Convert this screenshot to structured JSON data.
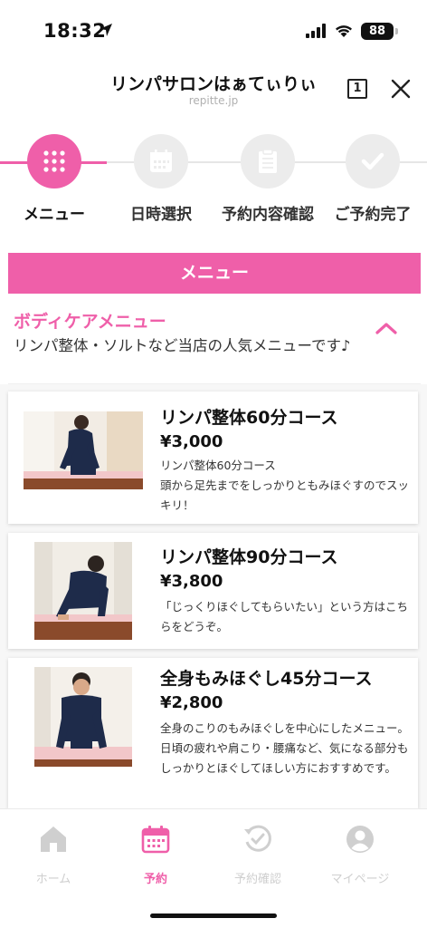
{
  "status_bar": {
    "time": "18:32",
    "battery": "88"
  },
  "header": {
    "title": "リンパサロンはぁてぃりぃ",
    "domain": "repitte.jp",
    "tabs_count": "1"
  },
  "steps": [
    {
      "label": "メニュー",
      "icon": "grid-dots-icon",
      "active": true
    },
    {
      "label": "日時選択",
      "icon": "calendar-icon",
      "active": false
    },
    {
      "label": "予約内容確認",
      "icon": "clipboard-icon",
      "active": false
    },
    {
      "label": "ご予約完了",
      "icon": "check-icon",
      "active": false
    }
  ],
  "section_title": "メニュー",
  "category": {
    "title": "ボディケアメニュー",
    "description": "リンパ整体・ソルトなど当店の人気メニューです♪"
  },
  "menu_items": [
    {
      "name": "リンパ整体60分コース",
      "price": "¥3,000",
      "subtitle": "リンパ整体60分コース",
      "description": "頭から足先までをしっかりともみほぐすのでスッキリ！"
    },
    {
      "name": "リンパ整体90分コース",
      "price": "¥3,800",
      "subtitle": "",
      "description": "「じっくりほぐしてもらいたい」という方はこちらをどうぞ。"
    },
    {
      "name": "全身もみほぐし45分コース",
      "price": "¥2,800",
      "subtitle": "",
      "description": "全身のこりのもみほぐしを中心にしたメニュー。日頃の疲れや肩こり・腰痛など、気になる部分もしっかりとほぐしてほしい方におすすめです。"
    }
  ],
  "bottom_nav": [
    {
      "label": "ホーム",
      "icon": "home-icon",
      "active": false
    },
    {
      "label": "予約",
      "icon": "calendar-icon",
      "active": true
    },
    {
      "label": "予約確認",
      "icon": "history-check-icon",
      "active": false
    },
    {
      "label": "マイページ",
      "icon": "user-icon",
      "active": false
    }
  ],
  "colors": {
    "accent": "#ef5fa9",
    "inactive": "#cfcfcf"
  }
}
